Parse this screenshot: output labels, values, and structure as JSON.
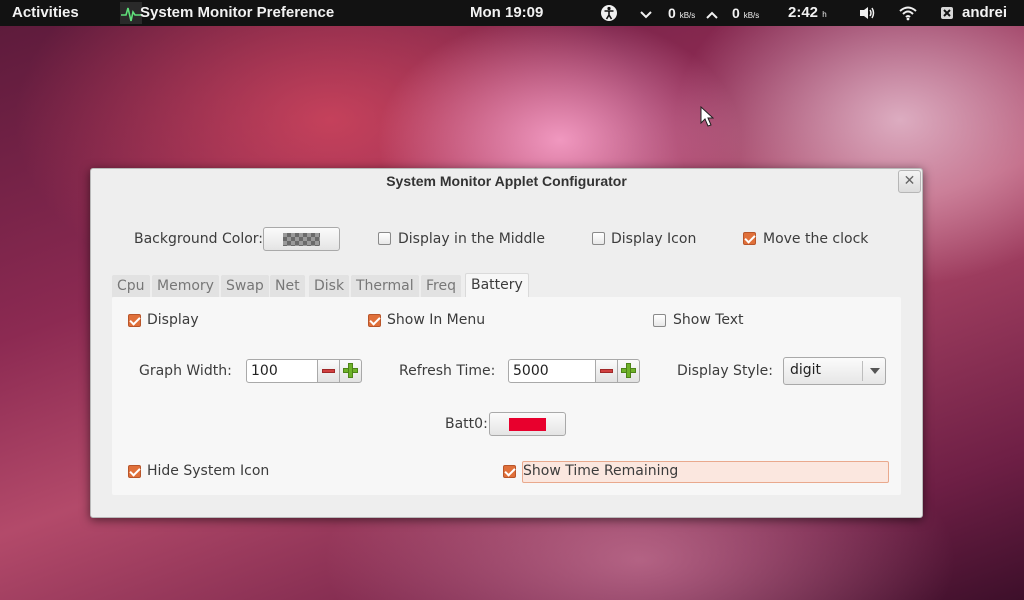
{
  "panel": {
    "activities": "Activities",
    "app_title": "System Monitor Preference",
    "clock": "Mon 19:09",
    "net_down_value": "0",
    "net_down_unit": "kB/s",
    "net_up_value": "0",
    "net_up_unit": "kB/s",
    "battery_time": "2:42",
    "battery_unit": "h",
    "user": "andrei"
  },
  "dialog": {
    "title": "System Monitor Applet Configurator",
    "close_glyph": "✕",
    "background_color_label": "Background Color:",
    "display_middle_label": "Display in the Middle",
    "display_middle_checked": false,
    "display_icon_label": "Display Icon",
    "display_icon_checked": false,
    "move_clock_label": "Move the clock",
    "move_clock_checked": true,
    "tabs": [
      "Cpu",
      "Memory",
      "Swap",
      "Net",
      "Disk",
      "Thermal",
      "Freq",
      "Battery"
    ],
    "active_tab": "Battery",
    "battery": {
      "display_label": "Display",
      "display_checked": true,
      "show_in_menu_label": "Show In Menu",
      "show_in_menu_checked": true,
      "show_text_label": "Show Text",
      "show_text_checked": false,
      "graph_width_label": "Graph Width:",
      "graph_width_value": "100",
      "refresh_time_label": "Refresh Time:",
      "refresh_time_value": "5000",
      "display_style_label": "Display Style:",
      "display_style_value": "digit",
      "batt0_label": "Batt0:",
      "batt0_color": "#e8002d",
      "hide_system_icon_label": "Hide System Icon",
      "hide_system_icon_checked": true,
      "show_time_remaining_label": "Show Time Remaining",
      "show_time_remaining_checked": true
    }
  },
  "colors": {
    "accent_checkbox": "#e0703a",
    "panel_bg": "#121212",
    "dialog_bg": "#eeeeee"
  }
}
